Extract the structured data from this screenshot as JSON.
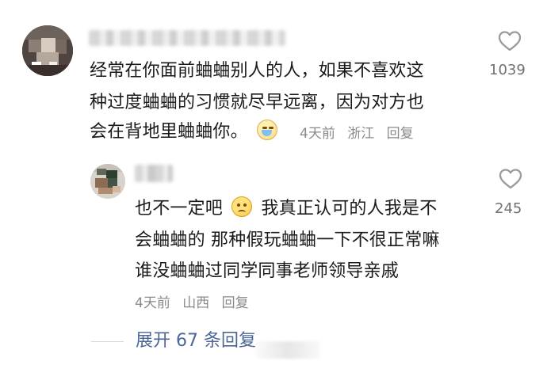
{
  "main_comment": {
    "text_lines": [
      "经常在你面前蛐蛐别人的人，如果不喜欢这",
      "种过度蛐蛐的习惯就尽早远离，因为对方也",
      "会在背地里蛐蛐你。"
    ],
    "emoji_name": "crying-face",
    "time": "4天前",
    "location": "浙江",
    "reply_label": "回复",
    "like_count": "1039"
  },
  "reply_comment": {
    "text_line1_before": "也不一定吧",
    "emoji_name": "grinning-face",
    "text_line1_after": "我真正认可的人我是不",
    "text_line2": "会蛐蛐的 那种假玩蛐蛐一下不很正常嘛",
    "text_line3": "谁没蛐蛐过同学同事老师领导亲戚",
    "time": "4天前",
    "location": "山西",
    "reply_label": "回复",
    "like_count": "245"
  },
  "expand": {
    "label": "展开 67 条回复"
  },
  "colors": {
    "text": "#1a1a1a",
    "meta": "#8a8a8a",
    "like": "#707070",
    "link": "#4c6797"
  }
}
